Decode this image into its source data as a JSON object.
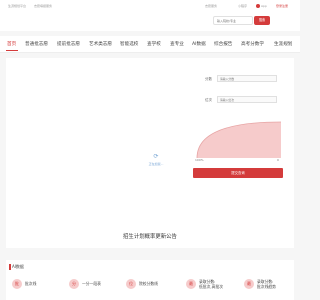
{
  "topbar": {
    "left_text_1": "生涯规划平台",
    "left_text_2": "志愿填报服务",
    "right_link_1": "志愿服务",
    "right_link_2": "小程序",
    "right_link_3": "App",
    "right_link_4": "登录注册"
  },
  "header": {
    "search_placeholder": "输入院校/专业",
    "search_button": "搜索"
  },
  "nav": {
    "items": [
      "首页",
      "普通批志愿",
      "提前批志愿",
      "艺术类志愿",
      "智能选校",
      "查学校",
      "查专业",
      "AI数据",
      "综合报告",
      "高考分数学",
      "生涯规划"
    ]
  },
  "form": {
    "label_1": "分数",
    "input_1_placeholder": "请输入分数",
    "label_2": "位次",
    "input_2_placeholder": "请输入位次",
    "gauge_min": "100%",
    "gauge_max": "0",
    "submit": "提交查询"
  },
  "loading": {
    "text": "正在加载..."
  },
  "announcement": {
    "title": "招生计划概率更新公告"
  },
  "ai": {
    "title": "AI数据",
    "cards": [
      {
        "icon": "批",
        "label_1": "批次线"
      },
      {
        "icon": "分",
        "label_1": "一分一段表"
      },
      {
        "icon": "位",
        "label_1": "院校分数线"
      },
      {
        "icon": "最",
        "label_1": "录取分数:",
        "label_2": "低批次,高批次"
      },
      {
        "icon": "最",
        "label_1": "录取分数:",
        "label_2": "批次线趋势"
      }
    ]
  },
  "colors": {
    "accent": "#d43b3b",
    "gauge_fill": "#f6cbcb"
  }
}
